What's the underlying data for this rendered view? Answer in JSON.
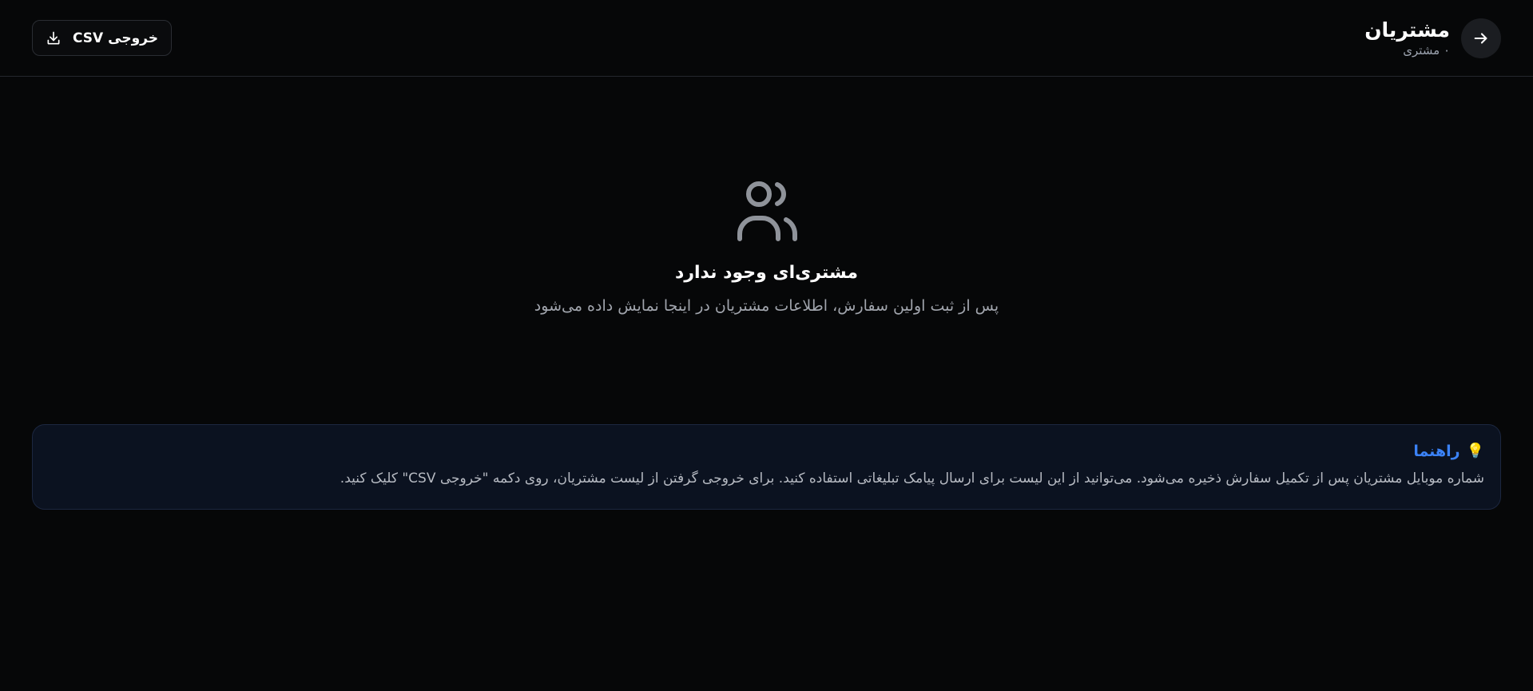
{
  "header": {
    "title": "مشتریان",
    "subtitle": "۰ مشتری",
    "back_icon": "arrow-right-icon",
    "export_button_label": "خروجی CSV",
    "export_icon": "download-icon"
  },
  "empty_state": {
    "icon": "users-icon",
    "title": "مشتری‌ای وجود ندارد",
    "description": "پس از ثبت اولین سفارش، اطلاعات مشتریان در اینجا نمایش داده می‌شود"
  },
  "tip": {
    "icon": "lightbulb-icon",
    "title": "راهنما",
    "text": "شماره موبایل مشتریان پس از تکمیل سفارش ذخیره می‌شود. می‌توانید از این لیست برای ارسال پیامک تبلیغاتی استفاده کنید. برای خروجی گرفتن از لیست مشتریان، روی دکمه \"خروجی CSV\" کلیک کنید."
  },
  "colors": {
    "background": "#060708",
    "accent": "#3b82f6",
    "tip_background": "#0b1220"
  }
}
